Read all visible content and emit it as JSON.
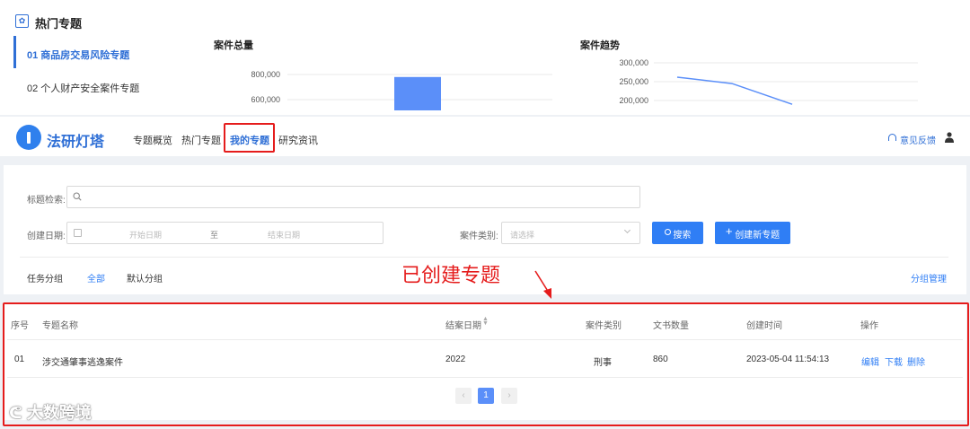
{
  "hot_topics": {
    "title": "热门专题",
    "items": [
      {
        "label": "01 商品房交易风险专题",
        "active": true
      },
      {
        "label": "02 个人财产安全案件专题",
        "active": false
      }
    ]
  },
  "charts": {
    "total_title": "案件总量",
    "trend_title": "案件趋势"
  },
  "chart_data": [
    {
      "type": "bar",
      "title": "案件总量",
      "ytick_labels": [
        "800,000",
        "600,000"
      ],
      "values": [
        780000
      ],
      "color": "#5b8ff9"
    },
    {
      "type": "line",
      "title": "案件趋势",
      "ytick_labels": [
        "300,000",
        "250,000",
        "200,000"
      ],
      "values": [
        262000,
        245000,
        190000
      ],
      "color": "#5b8ff9"
    }
  ],
  "header": {
    "app_name": "法研灯塔",
    "nav": [
      {
        "label": "专题概览",
        "active": false
      },
      {
        "label": "热门专题",
        "active": false
      },
      {
        "label": "我的专题",
        "active": true
      },
      {
        "label": "研究资讯",
        "active": false
      }
    ],
    "feedback": "意见反馈"
  },
  "search": {
    "title_label": "标题检索:",
    "date_label": "创建日期:",
    "date_start_placeholder": "开始日期",
    "date_sep": "至",
    "date_end_placeholder": "结束日期",
    "type_label": "案件类别:",
    "type_placeholder": "请选择",
    "search_button": "搜索",
    "create_button": "创建新专题"
  },
  "groups": {
    "label": "任务分组",
    "tabs": [
      {
        "label": "全部",
        "active": true
      },
      {
        "label": "默认分组",
        "active": false
      }
    ],
    "manage": "分组管理"
  },
  "annotation": "已创建专题",
  "table": {
    "headers": [
      "序号",
      "专题名称",
      "结案日期",
      "案件类别",
      "文书数量",
      "创建时间",
      "操作"
    ],
    "rows": [
      {
        "no": "01",
        "name": "涉交通肇事逃逸案件",
        "date": "2022",
        "type": "刑事",
        "count": "860",
        "created": "2023-05-04 11:54:13"
      }
    ],
    "ops": [
      "编辑",
      "下载",
      "删除"
    ]
  },
  "pagination": {
    "current": "1"
  },
  "watermark": "大数跨境",
  "colors": {
    "primary": "#2f7ef5",
    "highlight": "#e51c1c"
  }
}
